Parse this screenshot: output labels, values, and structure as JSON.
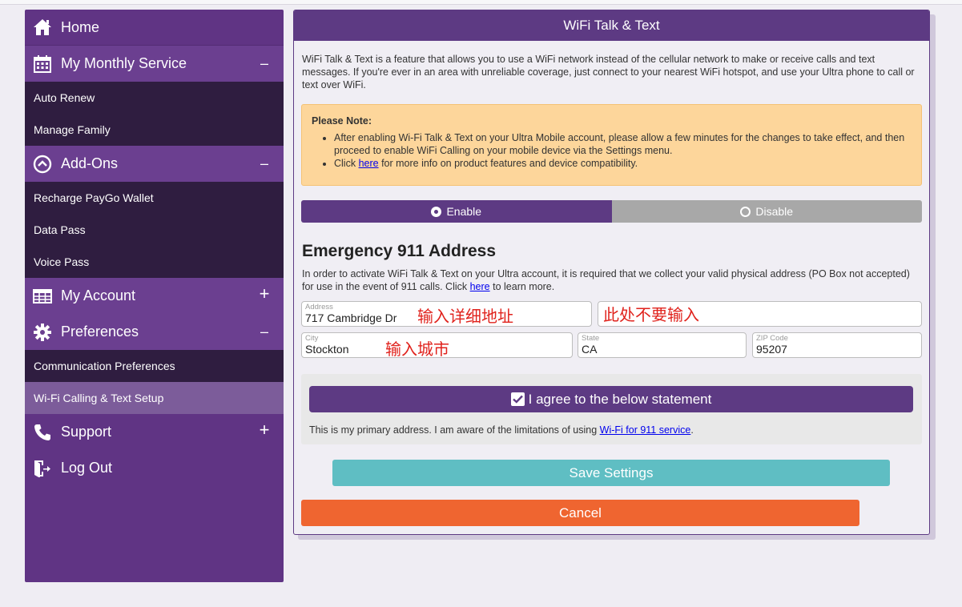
{
  "sidebar": {
    "home": "Home",
    "monthly_service": "My Monthly Service",
    "monthly_sub": [
      "Auto Renew",
      "Manage Family"
    ],
    "addons": "Add-Ons",
    "addons_sub": [
      "Recharge PayGo Wallet",
      "Data Pass",
      "Voice Pass"
    ],
    "account": "My Account",
    "preferences": "Preferences",
    "preferences_sub": [
      "Communication Preferences",
      "Wi-Fi Calling & Text Setup"
    ],
    "support": "Support",
    "logout": "Log Out",
    "collapse_symbol": "–",
    "expand_symbol": "+",
    "icons": {
      "home": "home-icon",
      "monthly_service": "calendar-icon",
      "addons": "chevron-up-circle-icon",
      "account": "table-icon",
      "preferences": "gear-icon",
      "support": "phone-icon",
      "logout": "logout-icon"
    }
  },
  "panel": {
    "title": "WiFi Talk & Text",
    "intro": "WiFi Talk & Text is a feature that allows you to use a WiFi network instead of the cellular network to make or receive calls and text messages. If you're ever in an area with unreliable coverage, just connect to your nearest WiFi hotspot, and use your Ultra phone to call or text over WiFi.",
    "note": {
      "title": "Please Note:",
      "bullet1": "After enabling Wi-Fi Talk & Text on your Ultra Mobile account, please allow a few minutes for the changes to take effect, and then proceed to enable WiFi Calling on your mobile device via the Settings menu.",
      "bullet2_pre": "Click ",
      "bullet2_link": "here",
      "bullet2_post": " for more info on product features and device compatibility."
    },
    "toggle": {
      "enable": "Enable",
      "disable": "Disable",
      "selected": "Enable"
    },
    "emergency": {
      "title": "Emergency 911 Address",
      "desc_pre": "In order to activate WiFi Talk & Text on your Ultra account, it is required that we collect your valid physical address (PO Box not accepted) for use in the event of 911 calls. Click ",
      "desc_link": "here",
      "desc_post": " to learn more."
    },
    "fields": {
      "address_label": "Address",
      "address_value": "717 Cambridge Dr",
      "address2_value": "",
      "city_label": "City",
      "city_value": "Stockton",
      "state_label": "State",
      "state_value": "CA",
      "zip_label": "ZIP Code",
      "zip_value": "95207"
    },
    "annotations": {
      "address": "输入详细地址",
      "address2": "此处不要输入",
      "city": "输入城市"
    },
    "agree": {
      "label": "I agree to the below statement",
      "checked": true,
      "text_pre": "This is my primary address. I am aware of the limitations of using ",
      "text_link": "Wi-Fi for 911 service",
      "text_post": "."
    },
    "save": "Save Settings",
    "cancel": "Cancel"
  },
  "colors": {
    "purple": "#5d3a83",
    "sidebar": "#603484",
    "sub_bg": "#2f1d40",
    "active_sub": "#7c5c9a",
    "note_bg": "#fdd69b",
    "save": "#5fbec3",
    "cancel": "#ef6530",
    "annotation": "#e0221c"
  }
}
